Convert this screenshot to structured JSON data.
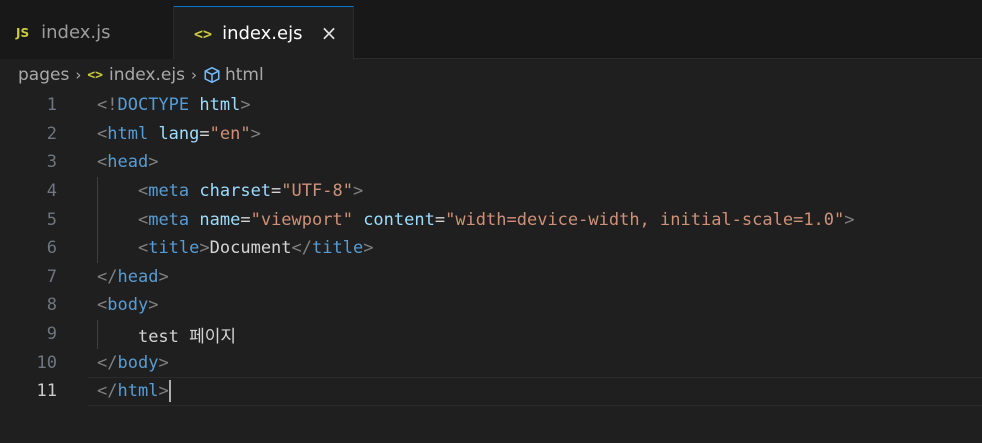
{
  "tabs": [
    {
      "badge": "JS",
      "label": "index.js",
      "active": false
    },
    {
      "icon": "<>",
      "label": "index.ejs",
      "active": true,
      "close": "×"
    }
  ],
  "breadcrumb": {
    "items": [
      "pages",
      "index.ejs",
      "html"
    ],
    "separator": "›"
  },
  "editor": {
    "line_numbers": [
      "1",
      "2",
      "3",
      "4",
      "5",
      "6",
      "7",
      "8",
      "9",
      "10",
      "11"
    ],
    "active_line": "11",
    "lines": {
      "l1": {
        "p1": "<!",
        "t1": "DOCTYPE",
        "a1": " html",
        "p2": ">"
      },
      "l2": {
        "p1": "<",
        "t1": "html",
        "a1": " lang",
        "x1": "=",
        "s1": "\"en\"",
        "p2": ">"
      },
      "l3": {
        "p1": "<",
        "t1": "head",
        "p2": ">"
      },
      "l4": {
        "indent": "    ",
        "p1": "<",
        "t1": "meta",
        "a1": " charset",
        "x1": "=",
        "s1": "\"UTF-8\"",
        "p2": ">"
      },
      "l5": {
        "indent": "    ",
        "p1": "<",
        "t1": "meta",
        "a1": " name",
        "x1": "=",
        "s1": "\"viewport\"",
        "a2": " content",
        "x2": "=",
        "s2": "\"width=device-width, initial-scale=1.0\"",
        "p2": ">"
      },
      "l6": {
        "indent": "    ",
        "p1": "<",
        "t1": "title",
        "p2": ">",
        "x1": "Document",
        "p3": "</",
        "t2": "title",
        "p4": ">"
      },
      "l7": {
        "p1": "</",
        "t1": "head",
        "p2": ">"
      },
      "l8": {
        "p1": "<",
        "t1": "body",
        "p2": ">"
      },
      "l9": {
        "indent": "    ",
        "x1": "test 페이지"
      },
      "l10": {
        "p1": "</",
        "t1": "body",
        "p2": ">"
      },
      "l11": {
        "p1": "</",
        "t1": "html",
        "p2": ">"
      }
    }
  },
  "colors": {
    "tag": "#569cd6",
    "attribute": "#9cdcfe",
    "string": "#ce9178",
    "punctuation": "#808080",
    "text": "#d4d4d4",
    "accent": "#0078d4"
  }
}
